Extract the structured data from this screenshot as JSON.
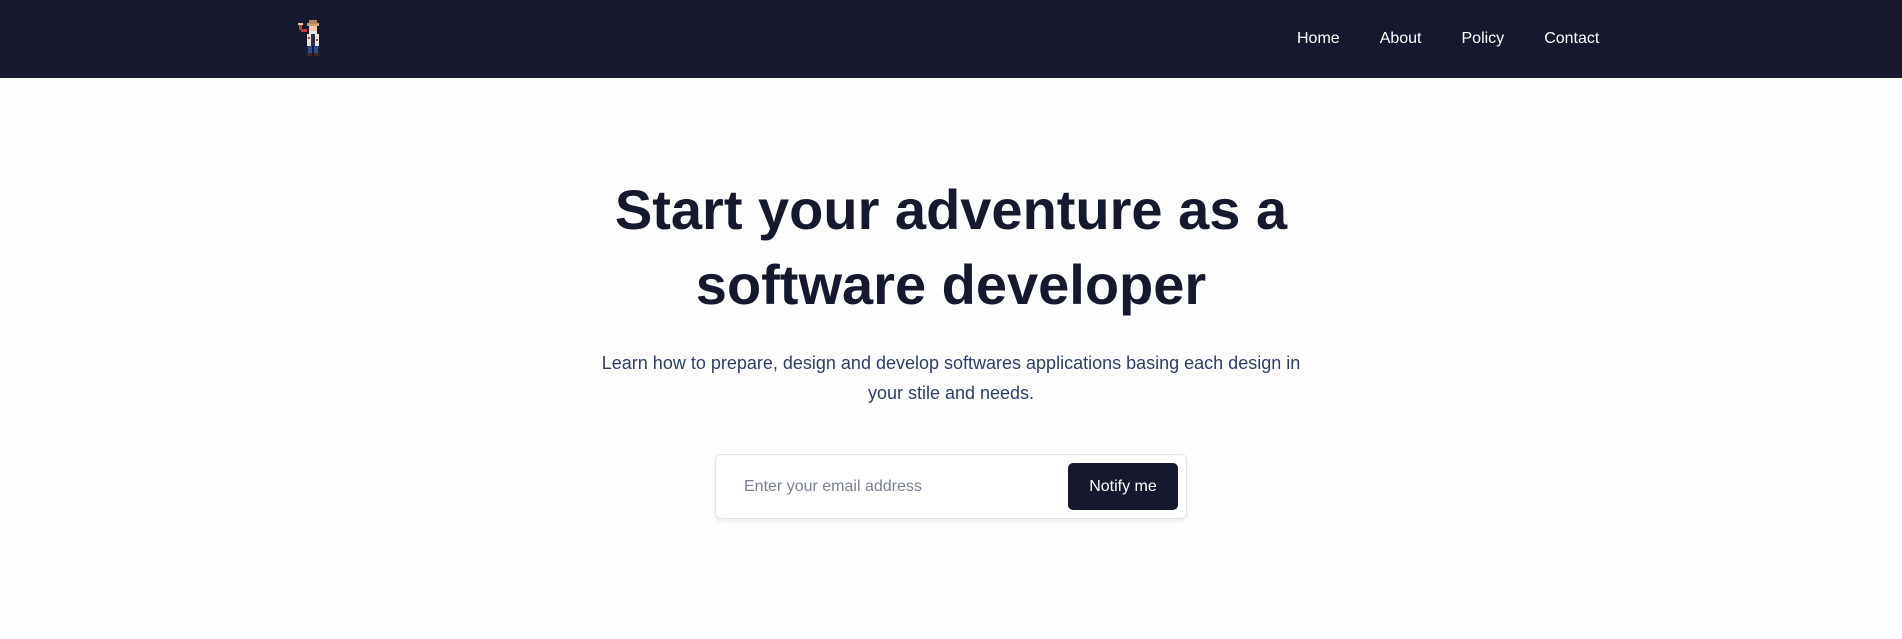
{
  "header": {
    "logo_icon": "adventurer-logo-icon",
    "nav": [
      {
        "label": "Home"
      },
      {
        "label": "About"
      },
      {
        "label": "Policy"
      },
      {
        "label": "Contact"
      }
    ]
  },
  "hero": {
    "title_line1": "Start your adventure as a",
    "title_line2": "software developer",
    "subtitle": "Learn how to prepare, design and develop softwares applications basing each design in your stile and needs."
  },
  "subscribe": {
    "email_placeholder": "Enter your email address",
    "email_value": "",
    "button_label": "Notify me"
  },
  "colors": {
    "header_bg": "#16192d",
    "title_text": "#16192d",
    "subtitle_text": "#2c3e6b",
    "button_bg": "#16192d"
  }
}
